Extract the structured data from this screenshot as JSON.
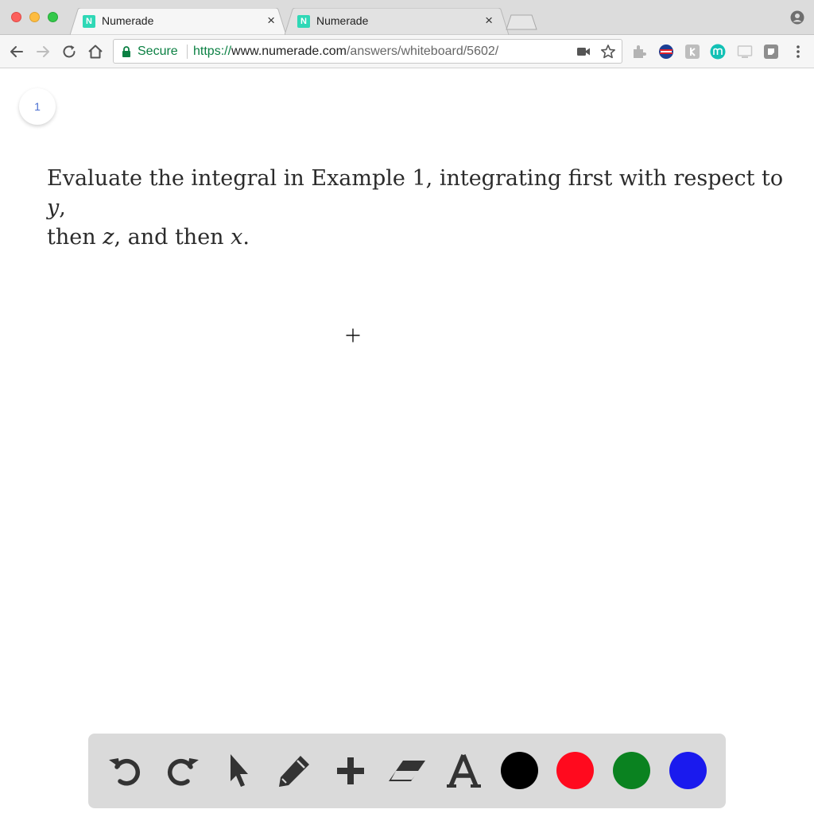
{
  "browser": {
    "tabs": [
      {
        "favicon": "N",
        "title": "Numerade",
        "active": true
      },
      {
        "favicon": "N",
        "title": "Numerade",
        "active": false
      }
    ],
    "close_glyph": "×",
    "address": {
      "secure_label": "Secure",
      "scheme": "https://",
      "host": "www.numerade.com",
      "path": "/answers/whiteboard/5602/"
    },
    "accent_color": "#0b8043"
  },
  "whiteboard": {
    "page_number": "1",
    "question": {
      "line1_text": "Evaluate the integral in Example 1, integrating first with respect to ",
      "line1_var": "y",
      "line1_end": ",",
      "line2_start": "then ",
      "line2_var1": "z",
      "line2_mid": ", and then ",
      "line2_var2": "x",
      "line2_end": "."
    }
  },
  "drawing_toolbar": {
    "tools": [
      "undo-icon",
      "redo-icon",
      "select-pointer-icon",
      "pencil-icon",
      "add-icon",
      "eraser-icon",
      "text-tool-icon"
    ],
    "colors": [
      "#000000",
      "#ff0a1e",
      "#0a8220",
      "#1a1aee"
    ]
  }
}
